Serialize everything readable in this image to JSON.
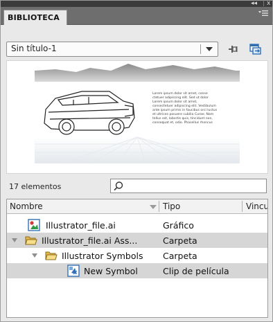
{
  "window": {
    "collapse_glyph": "◂◂",
    "close_glyph": "x"
  },
  "panel": {
    "tab_label": "BIBLIOTECA",
    "menu_icon": "panel-menu-icon"
  },
  "document": {
    "selected": "Sin título-1",
    "pin_icon": "pin-icon",
    "new_library_icon": "new-library-panel-icon"
  },
  "preview": {
    "lines": [
      "Lorem ipsum dolor sit amet, conse",
      "ctetuer adipiscing elit. Sed ut dolor",
      "Lorem ipsum dolor sit amet,",
      "consectetuer adipiscing elit. Vestibulum",
      "ante ipsum primis in faucibus orci luctus",
      "et ultrices posuere cubilia Curae; Nam",
      "tellus est, lobortis quis, tincidunt non,",
      "consequat et, odio. Phasellus rhoncus"
    ]
  },
  "library": {
    "count": "17 elementos",
    "search_value": "",
    "columns": {
      "name": "Nombre",
      "type": "Tipo",
      "linkage": "Vincul"
    },
    "items": [
      {
        "name": "Illustrator_file.ai",
        "type": "Gráfico",
        "icon": "graphic-symbol-icon"
      },
      {
        "name": "Illustrator_file.ai Ass...",
        "type": "Carpeta",
        "icon": "folder-icon"
      },
      {
        "name": "Illustrator Symbols",
        "type": "Carpeta",
        "icon": "folder-icon"
      },
      {
        "name": "New Symbol",
        "type": "Clip de película",
        "icon": "movie-clip-icon"
      }
    ]
  },
  "colors": {
    "panel_bg": "#e9e9e9",
    "tab_strip": "#6e6e6e",
    "title_strip": "#3b3b3b",
    "selected_row": "#d6d6d6"
  }
}
